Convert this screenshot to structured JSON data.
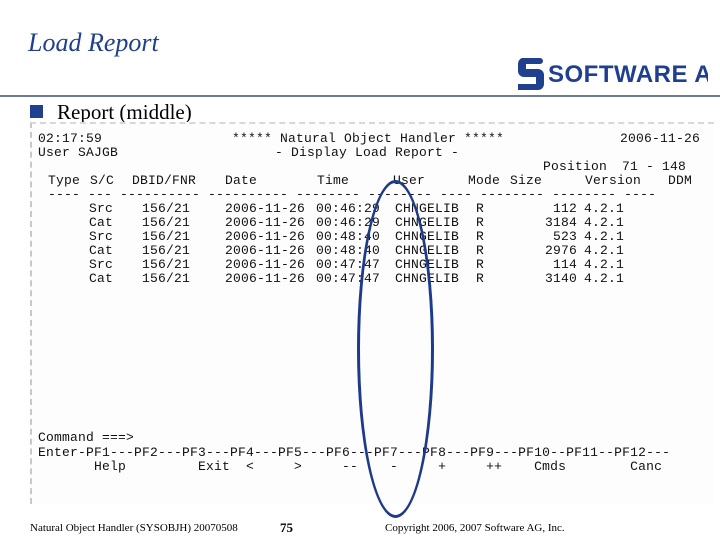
{
  "slide": {
    "title": "Load Report",
    "bullet": "Report (middle)",
    "logo_text": "SOFTWARE AG"
  },
  "screen": {
    "header_time": "02:17:59",
    "header_title": "***** Natural Object Handler *****",
    "header_date": "2006-11-26",
    "user_line": "User SAJGB",
    "subtitle": "- Display Load Report -",
    "position_label": "Position",
    "position_value": "71 - 148",
    "columns": {
      "type": "Type",
      "sc": "S/C",
      "dbidfnr": "DBID/FNR",
      "date": "Date",
      "time": "Time",
      "user": "User",
      "mode": "Mode",
      "size": "Size",
      "version": "Version",
      "ddm": "DDM"
    },
    "separator": "---- --- ---------- ---------- -------- -------- ---- -------- -------- ----",
    "rows": [
      {
        "sc": "Src",
        "dbid": "156/21",
        "date": "2006-11-26",
        "time": "00:46:29",
        "user": "CHNGELIB",
        "mode": "R",
        "size": "112",
        "version": "4.2.1"
      },
      {
        "sc": "Cat",
        "dbid": "156/21",
        "date": "2006-11-26",
        "time": "00:46:29",
        "user": "CHNGELIB",
        "mode": "R",
        "size": "3184",
        "version": "4.2.1"
      },
      {
        "sc": "Src",
        "dbid": "156/21",
        "date": "2006-11-26",
        "time": "00:48:40",
        "user": "CHNGELIB",
        "mode": "R",
        "size": "523",
        "version": "4.2.1"
      },
      {
        "sc": "Cat",
        "dbid": "156/21",
        "date": "2006-11-26",
        "time": "00:48:40",
        "user": "CHNGELIB",
        "mode": "R",
        "size": "2976",
        "version": "4.2.1"
      },
      {
        "sc": "Src",
        "dbid": "156/21",
        "date": "2006-11-26",
        "time": "00:47:47",
        "user": "CHNGELIB",
        "mode": "R",
        "size": "114",
        "version": "4.2.1"
      },
      {
        "sc": "Cat",
        "dbid": "156/21",
        "date": "2006-11-26",
        "time": "00:47:47",
        "user": "CHNGELIB",
        "mode": "R",
        "size": "3140",
        "version": "4.2.1"
      }
    ],
    "command_prompt": "Command ===>",
    "pf_line": "Enter-PF1---PF2---PF3---PF4---PF5---PF6---PF7---PF8---PF9---PF10--PF11--PF12---",
    "pf_labels": "       Help         Exit  <     >     --    -     +     ++    Cmds        Canc"
  },
  "footer": {
    "left": "Natural Object Handler (SYSOBJH) 20070508",
    "page": "75",
    "copyright": "Copyright 2006, 2007 Software AG, Inc."
  },
  "colors": {
    "title": "#1f3f8f",
    "highlight_ellipse": "#1e3a8a",
    "logo": "#1f3f8f"
  }
}
